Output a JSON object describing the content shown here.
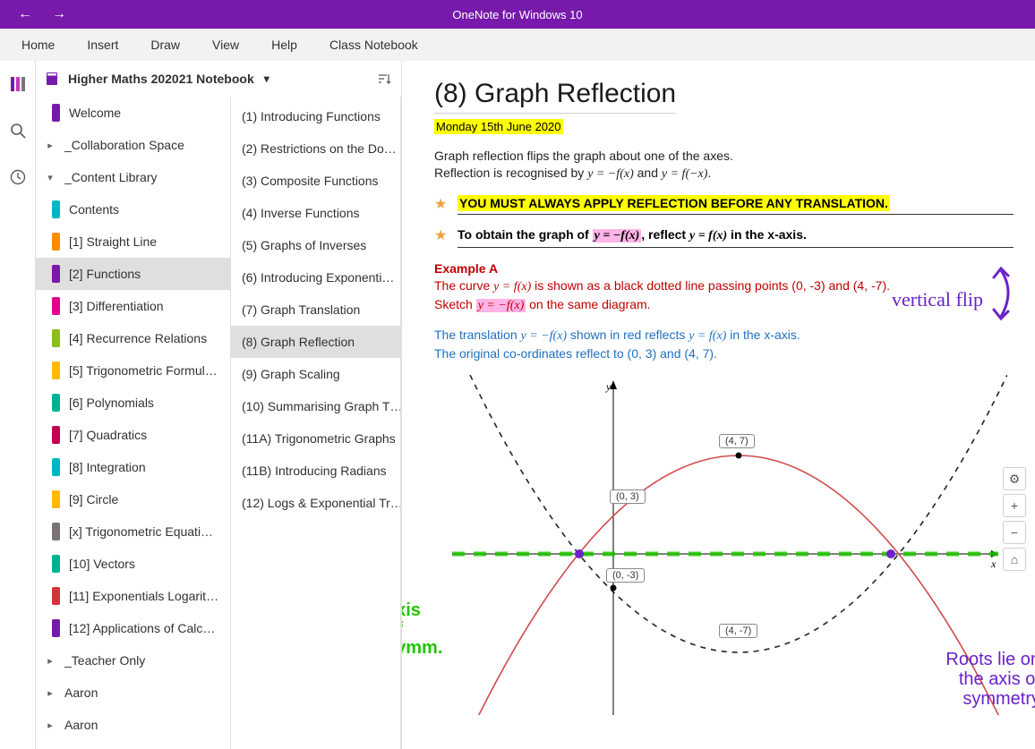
{
  "app_title": "OneNote for Windows 10",
  "menu": [
    "Home",
    "Insert",
    "Draw",
    "View",
    "Help",
    "Class Notebook"
  ],
  "notebook_name": "Higher Maths 202021 Notebook",
  "sections_top": [
    {
      "label": "Welcome",
      "color": "#7719aa",
      "caret": "",
      "sub": true
    },
    {
      "label": "_Collaboration Space",
      "caret": ">",
      "sub": false
    },
    {
      "label": "_Content Library",
      "caret": "v",
      "sub": false
    }
  ],
  "content_library": [
    {
      "label": "Contents",
      "color": "#00b7c3"
    },
    {
      "label": "[1] Straight Line",
      "color": "#ff8c00"
    },
    {
      "label": "[2] Functions",
      "color": "#7719aa",
      "selected": true
    },
    {
      "label": "[3] Differentiation",
      "color": "#e3008c"
    },
    {
      "label": "[4] Recurrence Relations",
      "color": "#8cbd18"
    },
    {
      "label": "[5] Trigonometric Formul…",
      "color": "#ffb900"
    },
    {
      "label": "[6] Polynomials",
      "color": "#00b294"
    },
    {
      "label": "[7] Quadratics",
      "color": "#c30052"
    },
    {
      "label": "[8] Integration",
      "color": "#00b7c3"
    },
    {
      "label": "[9] Circle",
      "color": "#ffb900"
    },
    {
      "label": "[x] Trigonometric Equati…",
      "color": "#7a7574"
    },
    {
      "label": "[10] Vectors",
      "color": "#00b294"
    },
    {
      "label": "[11] Exponentials Logarit…",
      "color": "#d13438"
    },
    {
      "label": "[12] Applications of Calc…",
      "color": "#7719aa"
    }
  ],
  "sections_bottom": [
    {
      "label": "_Teacher Only",
      "caret": ">",
      "sub": false
    },
    {
      "label": "Aaron",
      "caret": ">",
      "sub": false
    },
    {
      "label": "Aaron",
      "caret": ">",
      "sub": false
    }
  ],
  "pages": [
    "(1) Introducing Functions",
    "(2) Restrictions on the Do…",
    "(3) Composite Functions",
    "(4) Inverse Functions",
    "(5) Graphs of Inverses",
    "(6) Introducing Exponenti…",
    "(7) Graph Translation",
    "(8) Graph Reflection",
    "(9) Graph Scaling",
    "(10) Summarising Graph T…",
    "(11A) Trigonometric Graphs",
    "(11B) Introducing Radians",
    "(12) Logs & Exponential Tr…"
  ],
  "selected_page_index": 7,
  "page": {
    "title": "(8) Graph Reflection",
    "date": "Monday 15th June 2020",
    "intro_line1": "Graph reflection flips the graph about one of the axes.",
    "intro_line2_a": "Reflection is recognised by  ",
    "intro_line2_b": "y = −f(x)",
    "intro_line2_c": " and ",
    "intro_line2_d": "y = f(−x)",
    "intro_line2_e": ".",
    "warn": "YOU MUST ALWAYS APPLY REFLECTION BEFORE ANY TRANSLATION.",
    "rule_a": "To obtain the graph of ",
    "rule_b": "y = −f(x)",
    "rule_c": ", reflect ",
    "rule_d": "y = f(x)",
    "rule_e": " in the x-axis.",
    "ink_vf": "vertical flip",
    "ex_title": "Example A",
    "ex_l1a": "The curve ",
    "ex_l1b": "y = f(x)",
    "ex_l1c": " is shown as a black dotted line passing points (0, -3) and (4, -7).",
    "ex_l2a": "Sketch ",
    "ex_l2b": "y = −f(x)",
    "ex_l2c": " on the same diagram.",
    "ans_l1a": "The translation ",
    "ans_l1b": "y = −f(x)",
    "ans_l1c": " shown in red reflects ",
    "ans_l1d": "y = f(x)",
    "ans_l1e": " in the x-axis.",
    "ans_l2": "The original co-ordinates reflect to (0, 3) and (4, 7).",
    "pt1": "(4, 7)",
    "pt2": "(0, 3)",
    "pt3": "(0, -3)",
    "pt4": "(4, -7)",
    "axis_x": "x",
    "axis_y": "y",
    "ink_axis1": "axis",
    "ink_axis2": "of",
    "ink_axis3": "symm.",
    "ink_roots1": "Roots lie on",
    "ink_roots2": "the axis of",
    "ink_roots3": "symmetry"
  },
  "toolbtns": [
    "⚙",
    "+",
    "−",
    "⌂"
  ]
}
